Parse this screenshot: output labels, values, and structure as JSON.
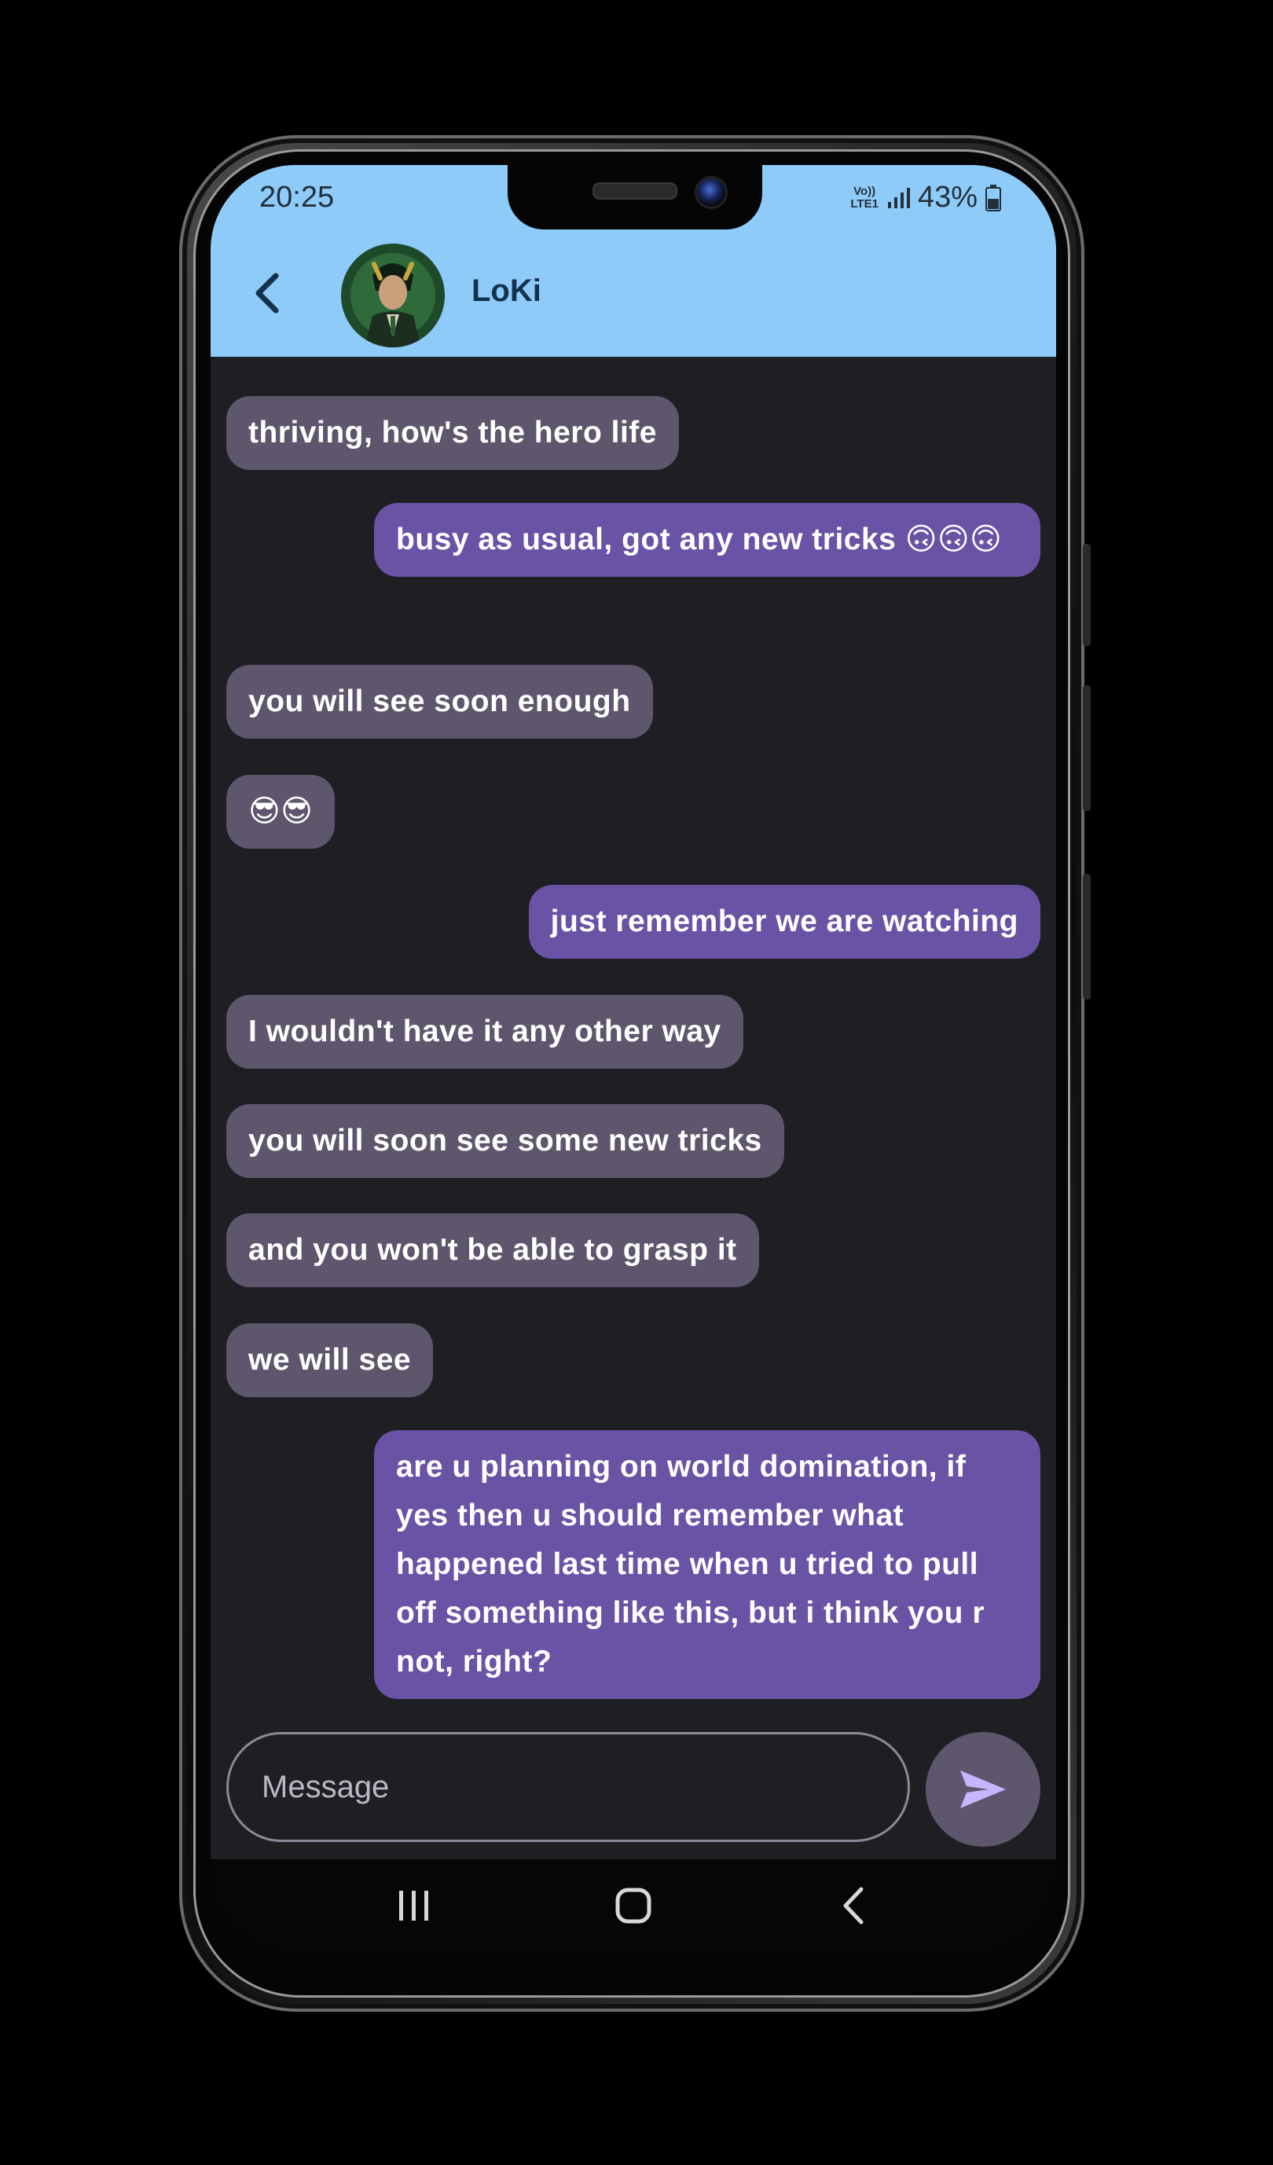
{
  "status_bar": {
    "time": "20:25",
    "network_top": "Vo))",
    "network_bottom": "LTE1",
    "battery": "43%"
  },
  "header": {
    "contact_name": "LoKi",
    "back_icon": "chevron-left-icon",
    "avatar_icon": "contact-avatar"
  },
  "messages": [
    {
      "direction": "incoming",
      "text": "thriving, how's the hero life"
    },
    {
      "direction": "outgoing",
      "text": "busy as usual, got any new tricks 🙃🙃🙃"
    },
    {
      "direction": "incoming",
      "text": "you will see soon enough"
    },
    {
      "direction": "incoming",
      "text": "😎😎"
    },
    {
      "direction": "outgoing",
      "text": "just remember we are watching"
    },
    {
      "direction": "incoming",
      "text": "I wouldn't have it any other way"
    },
    {
      "direction": "incoming",
      "text": "you will soon see some new tricks"
    },
    {
      "direction": "incoming",
      "text": "and you won't be able to grasp it"
    },
    {
      "direction": "incoming",
      "text": "we will see"
    },
    {
      "direction": "outgoing",
      "text": "are u planning on world domination, if yes then u should remember what happened last time when u tried to pull off something like this, but i think you r not, right?"
    }
  ],
  "composer": {
    "placeholder": "Message",
    "value": "",
    "send_icon": "send-icon"
  },
  "nav_bar": {
    "recents_icon": "recents-icon",
    "home_icon": "home-icon",
    "back_icon": "back-icon"
  },
  "colors": {
    "header_bg": "#8ecbf9",
    "chat_bg": "#1d1f22",
    "incoming_bubble": "#5e566d",
    "outgoing_bubble": "#6a52a5",
    "send_arrow": "#c8b4ff"
  }
}
